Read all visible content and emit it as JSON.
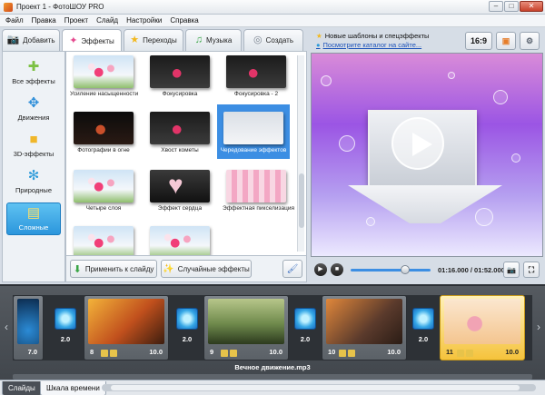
{
  "window": {
    "title": "Проект 1 - ФотоШОУ PRO",
    "min": "–",
    "max": "□",
    "close": "✕"
  },
  "menu": [
    "Файл",
    "Правка",
    "Проект",
    "Слайд",
    "Настройки",
    "Справка"
  ],
  "tabs": [
    {
      "label": "Добавить",
      "icon": "camera-icon"
    },
    {
      "label": "Эффекты",
      "icon": "effects-icon"
    },
    {
      "label": "Переходы",
      "icon": "star-icon"
    },
    {
      "label": "Музыка",
      "icon": "music-note-icon"
    },
    {
      "label": "Создать",
      "icon": "disc-icon"
    }
  ],
  "categories": [
    {
      "label": "Все эффекты",
      "icon": "puzzle-icon"
    },
    {
      "label": "Движения",
      "icon": "arrows-icon"
    },
    {
      "label": "3D-эффекты",
      "icon": "cube-icon"
    },
    {
      "label": "Природные",
      "icon": "snowflake-icon"
    },
    {
      "label": "Сложные",
      "icon": "layers-icon"
    }
  ],
  "effects": [
    {
      "label": "Усиление насыщенности"
    },
    {
      "label": "Фокусировка"
    },
    {
      "label": "Фокусировка - 2"
    },
    {
      "label": "Фотографии в огне"
    },
    {
      "label": "Хвост кометы"
    },
    {
      "label": "Чередование эффектов"
    },
    {
      "label": "Четыре слоя"
    },
    {
      "label": "Эффект сердца"
    },
    {
      "label": "Эффектная пикселизация"
    },
    {
      "label": ""
    },
    {
      "label": ""
    }
  ],
  "buttons": {
    "apply": "Применить к слайду",
    "random": "Случайные эффекты"
  },
  "right_top": {
    "news": "Новые шаблоны и спецэффекты",
    "catalog": "Посмотрите каталог на сайте...",
    "aspect": "16:9"
  },
  "player": {
    "time": "01:16.000 / 01:52.000",
    "progress": 0.68
  },
  "timeline": {
    "slides": [
      {
        "num": "",
        "dur": "7.0"
      },
      {
        "num": "8",
        "dur": "10.0"
      },
      {
        "num": "9",
        "dur": "10.0"
      },
      {
        "num": "10",
        "dur": "10.0"
      },
      {
        "num": "11",
        "dur": "10.0"
      }
    ],
    "transitions": [
      "2.0",
      "2.0",
      "2.0",
      "2.0"
    ],
    "music": "Вечное движение.mp3"
  },
  "bottom_tabs": [
    "Слайды",
    "Шкала времени"
  ]
}
